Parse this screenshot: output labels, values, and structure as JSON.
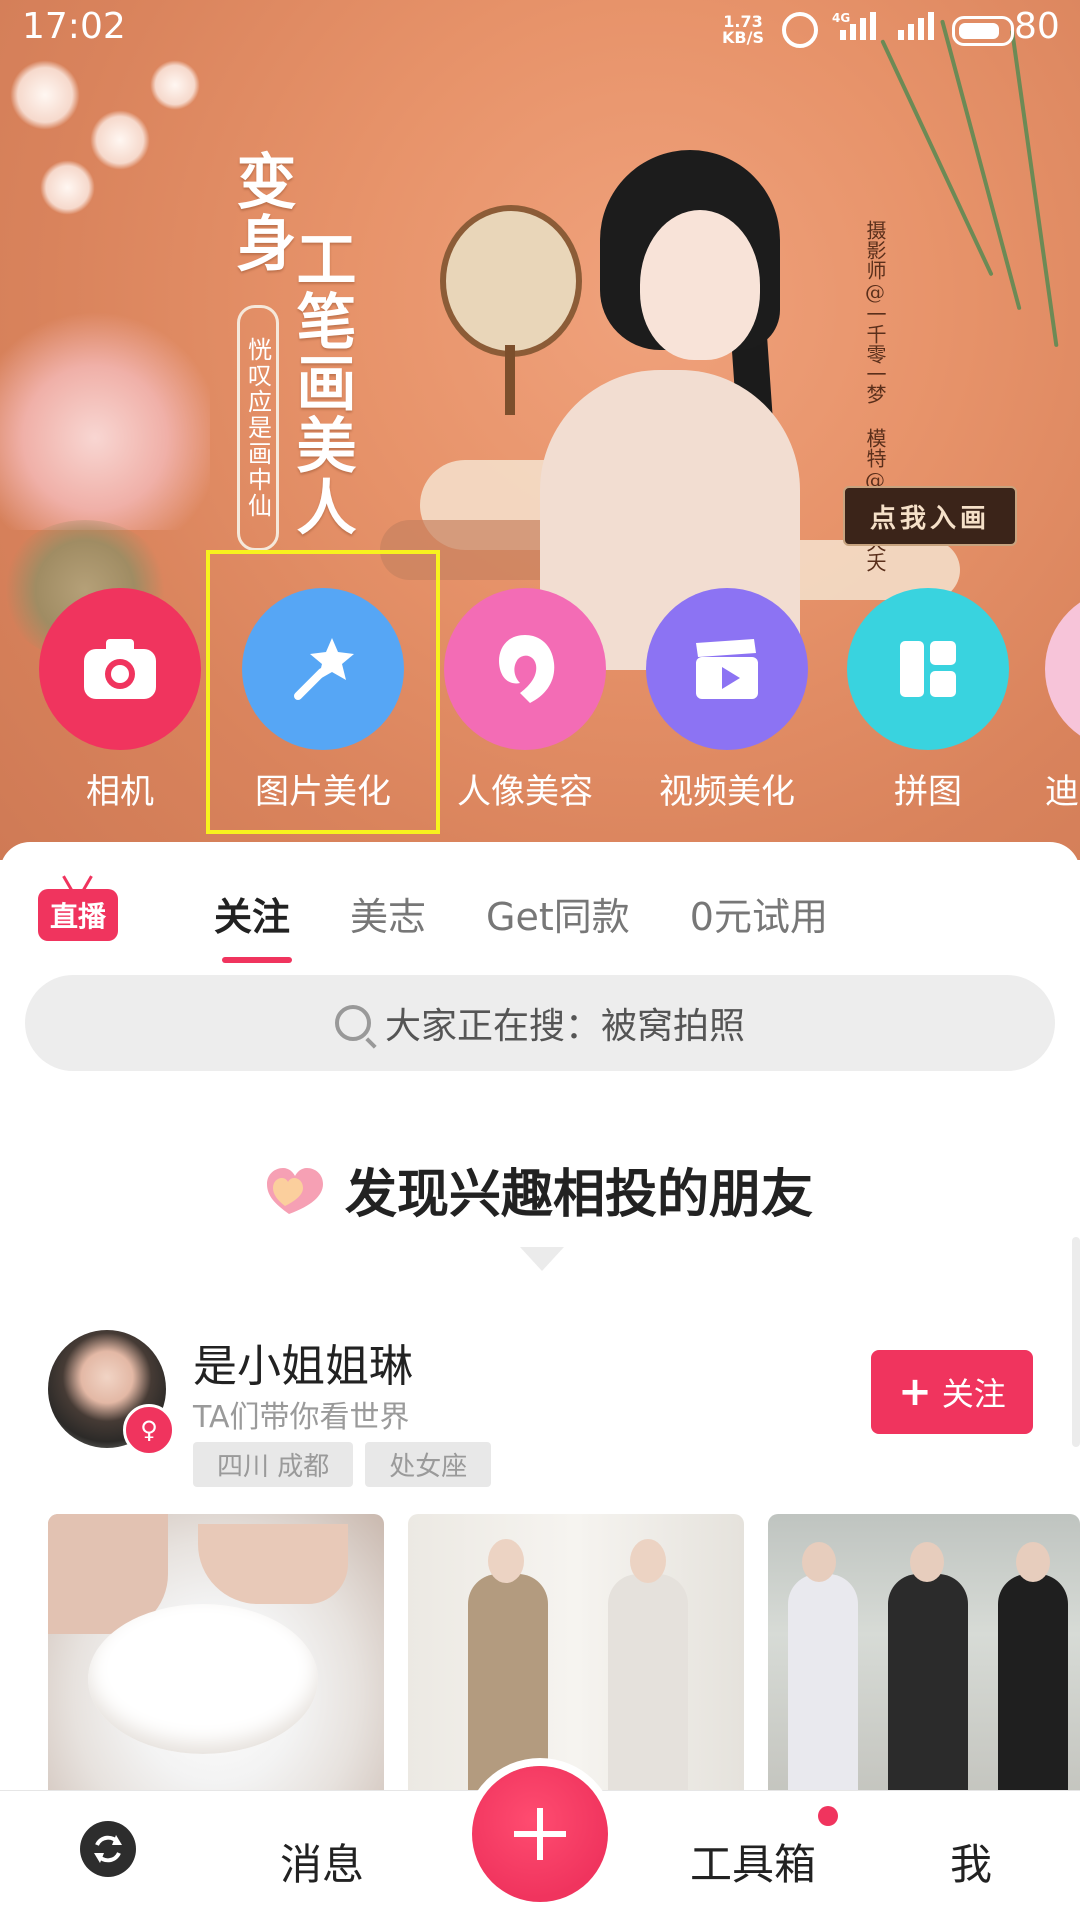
{
  "status_bar": {
    "time": "17:02",
    "net_speed": "1.73",
    "net_unit": "KB/S",
    "signal": "4G",
    "battery": "80"
  },
  "banner": {
    "title_col1": "变身",
    "title_col2": "工笔画美人",
    "subtitle": "恍叹应是画中仙",
    "credit_photographer": "摄影师@一千零一梦",
    "credit_model": "模特@桃夭夭夭",
    "cta": "点我入画"
  },
  "tools": [
    {
      "label": "相机",
      "color": "#f0345e",
      "icon": "camera-icon"
    },
    {
      "label": "图片美化",
      "color": "#56a6f5",
      "icon": "magic-wand-icon"
    },
    {
      "label": "人像美容",
      "color": "#f36cb5",
      "icon": "face-icon"
    },
    {
      "label": "视频美化",
      "color": "#8c73f3",
      "icon": "clapperboard-icon"
    },
    {
      "label": "拼图",
      "color": "#39d3df",
      "icon": "collage-icon"
    },
    {
      "label": "迪"
    }
  ],
  "feed": {
    "live_badge": "直播",
    "tabs": [
      "关注",
      "美志",
      "Get同款",
      "0元试用"
    ],
    "active_tab": "关注",
    "search_text": "大家正在搜：被窝拍照",
    "section_title": "发现兴趣相投的朋友",
    "user": {
      "name": "是小姐姐琳",
      "subtitle": "TA们带你看世界",
      "tags": [
        "四川 成都",
        "处女座"
      ],
      "follow_label": "关注",
      "gender_icon": "female-icon"
    }
  },
  "nav": {
    "messages": "消息",
    "toolbox": "工具箱",
    "me": "我"
  },
  "colors": {
    "accent": "#f0345e",
    "highlight_box": "#f8f21e"
  }
}
